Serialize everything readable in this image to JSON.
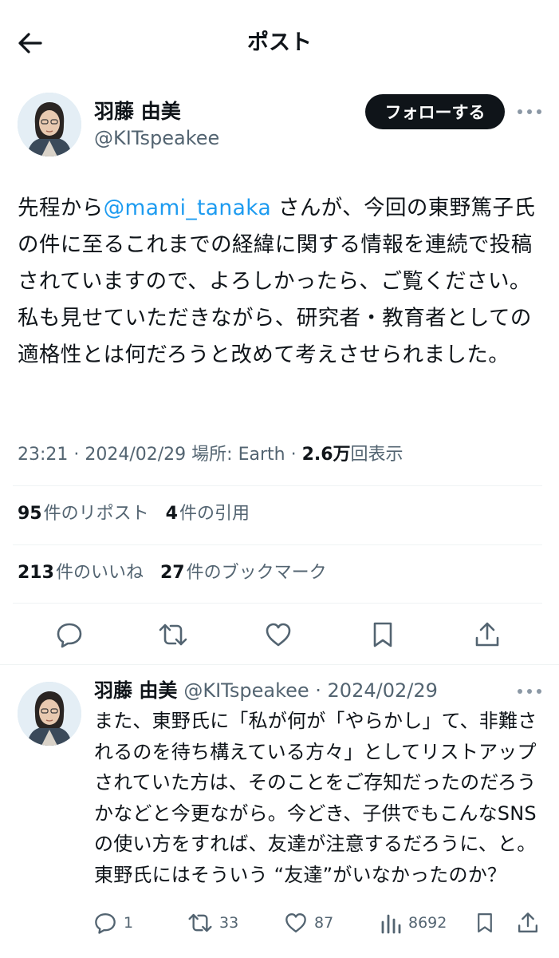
{
  "header": {
    "title": "ポスト"
  },
  "post": {
    "author_name": "羽藤 由美",
    "author_handle": "@KITspeakee",
    "follow_label": "フォローする",
    "text_before": "先程から",
    "mention": "@mami_tanaka",
    "text_after": " さんが、今回の東野篤子氏の件に至るこれまでの経緯に関する情報を連続で投稿されていますので、よろしかったら、ご覧ください。私も見せていただきながら、研究者・教育者としての適格性とは何だろうと改めて考えさせられました。",
    "meta_prefix": "23:21 · 2024/02/29 場所: Earth · ",
    "views_count": "2.6万",
    "views_label": "回表示",
    "reposts_count": "95",
    "reposts_label": "件のリポスト",
    "quotes_count": "4",
    "quotes_label": "件の引用",
    "likes_count": "213",
    "likes_label": "件のいいね",
    "bookmarks_count": "27",
    "bookmarks_label": "件のブックマーク"
  },
  "reply": {
    "author_name": "羽藤 由美",
    "author_handle_date": "@KITspeakee · 2024/02/29",
    "text": "また、東野氏に「私が何が「やらかし」て、非難されるのを待ち構えている方々」としてリストアップされていた方は、そのことをご存知だったのだろうかなどと今更ながら。今どき、子供でもこんなSNSの使い方をすれば、友達が注意するだろうに、と。東野氏にはそういう “友達”がいなかったのか？",
    "replies": "1",
    "reposts": "33",
    "likes": "87",
    "views": "8692"
  },
  "colors": {
    "accent": "#1d9bf0",
    "text_primary": "#0f1419",
    "text_secondary": "#536471",
    "divider": "#eff3f4",
    "follow_bg": "#0f1419"
  },
  "icons": [
    "back-arrow-icon",
    "more-icon",
    "reply-icon",
    "repost-icon",
    "like-icon",
    "bookmark-icon",
    "share-icon",
    "views-icon"
  ]
}
